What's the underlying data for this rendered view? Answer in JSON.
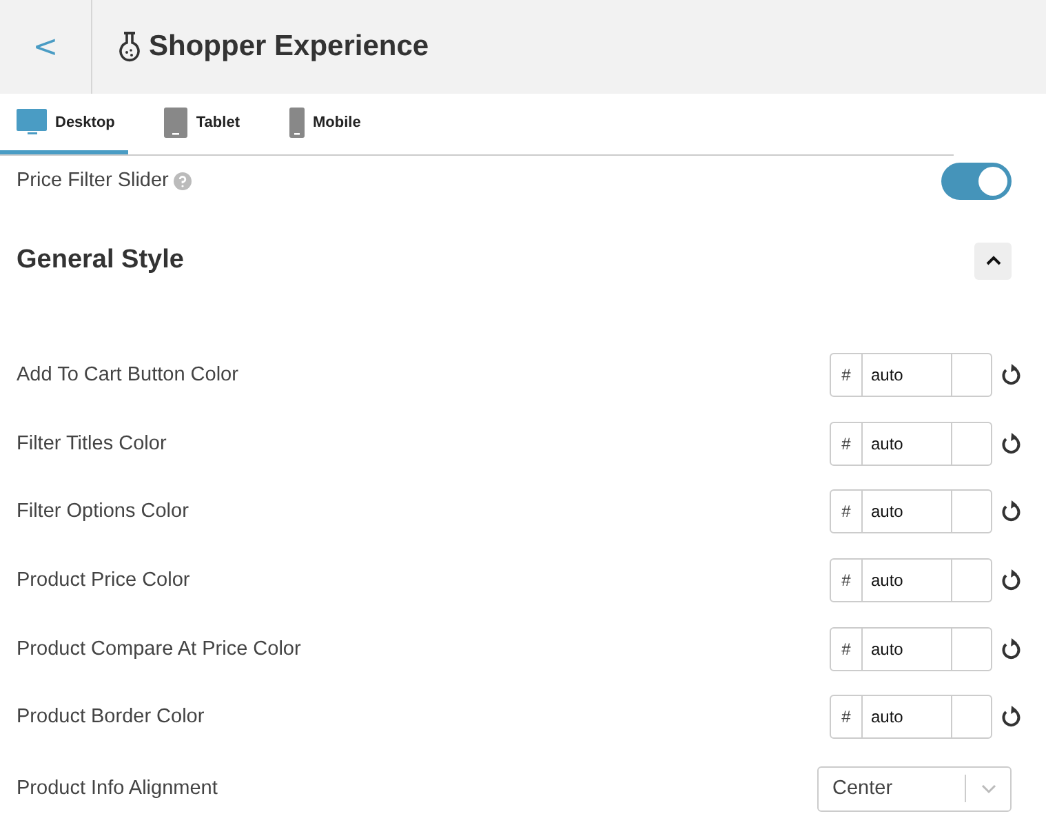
{
  "header": {
    "back": "<",
    "title": "Shopper Experience"
  },
  "tabs": [
    {
      "label": "Desktop",
      "kind": "desktop",
      "selected": true
    },
    {
      "label": "Tablet",
      "kind": "tablet",
      "selected": false
    },
    {
      "label": "Mobile",
      "kind": "mobile",
      "selected": false
    }
  ],
  "price_filter": {
    "label": "Price Filter Slider",
    "on": true
  },
  "section": {
    "title": "General Style",
    "expanded": true,
    "rows": [
      {
        "kind": "color",
        "label": "Add To Cart Button Color",
        "prefix": "#",
        "value": "auto"
      },
      {
        "kind": "color",
        "label": "Filter Titles Color",
        "prefix": "#",
        "value": "auto"
      },
      {
        "kind": "color",
        "label": "Filter Options Color",
        "prefix": "#",
        "value": "auto"
      },
      {
        "kind": "color",
        "label": "Product Price Color",
        "prefix": "#",
        "value": "auto"
      },
      {
        "kind": "color",
        "label": "Product Compare At Price Color",
        "prefix": "#",
        "value": "auto"
      },
      {
        "kind": "color",
        "label": "Product Border Color",
        "prefix": "#",
        "value": "auto"
      },
      {
        "kind": "select",
        "label": "Product Info Alignment",
        "value": "Center"
      }
    ]
  }
}
